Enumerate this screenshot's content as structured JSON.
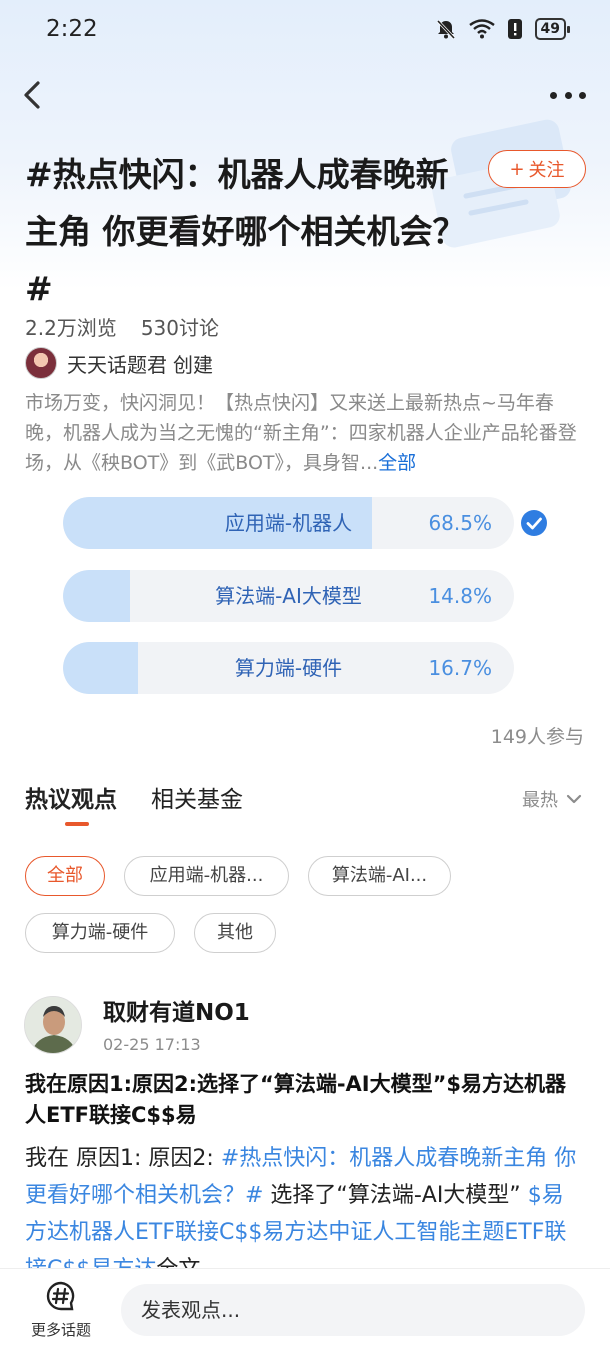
{
  "status_bar": {
    "time": "2:22",
    "battery": "49"
  },
  "topic": {
    "title": "#热点快闪：机器人成春晚新主角 你更看好哪个相关机会？#",
    "follow_label": "关注",
    "views": "2.2万浏览",
    "discussions": "530讨论",
    "creator_name": "天天话题君",
    "creator_suffix": "创建",
    "description": "市场万变，快闪洞见！【热点快闪】又来送上最新热点~马年春晚，机器人成为当之无愧的“新主角”：四家机器人企业产品轮番登场，从《秧BOT》到《武BOT》，具身智...",
    "description_more": "全部"
  },
  "poll": {
    "options": [
      {
        "label": "应用端-机器人",
        "percent_text": "68.5%",
        "fraction": 0.685,
        "selected": true
      },
      {
        "label": "算法端-AI大模型",
        "percent_text": "14.8%",
        "fraction": 0.148,
        "selected": false
      },
      {
        "label": "算力端-硬件",
        "percent_text": "16.7%",
        "fraction": 0.167,
        "selected": false
      }
    ],
    "participants": "149人参与"
  },
  "tabs": [
    {
      "label": "热议观点",
      "active": true
    },
    {
      "label": "相关基金",
      "active": false
    }
  ],
  "sort_label": "最热",
  "filters": [
    "全部",
    "应用端-机器...",
    "算法端-AI...",
    "算力端-硬件",
    "其他"
  ],
  "post": {
    "author": "取财有道NO1",
    "time": "02-25 17:13",
    "title": "我在原因1:原因2:选择了“算法端-AI大模型”$易方达机器人ETF联接C$$易",
    "body_prefix": "我在 原因1: 原因2: ",
    "body_link1": "#热点快闪：机器人成春晚新主角 你更看好哪个相关机会？#",
    "body_mid": " 选择了“算法端-AI大模型” ",
    "body_link2": "$易方达机器人ETF联接C$$易方达中证人工智能主题ETF联接C$$易方达",
    "body_more": "全文"
  },
  "bottom_bar": {
    "more_topics_label": "更多话题",
    "input_placeholder": "发表观点..."
  },
  "colors": {
    "accent": "#e8582c",
    "link": "#3a86e0",
    "poll_fill": "#c9e0f9"
  },
  "icons": [
    "back-arrow-icon",
    "more-dots-icon",
    "check-circle-icon",
    "chevron-down-icon",
    "hash-bubble-icon"
  ]
}
